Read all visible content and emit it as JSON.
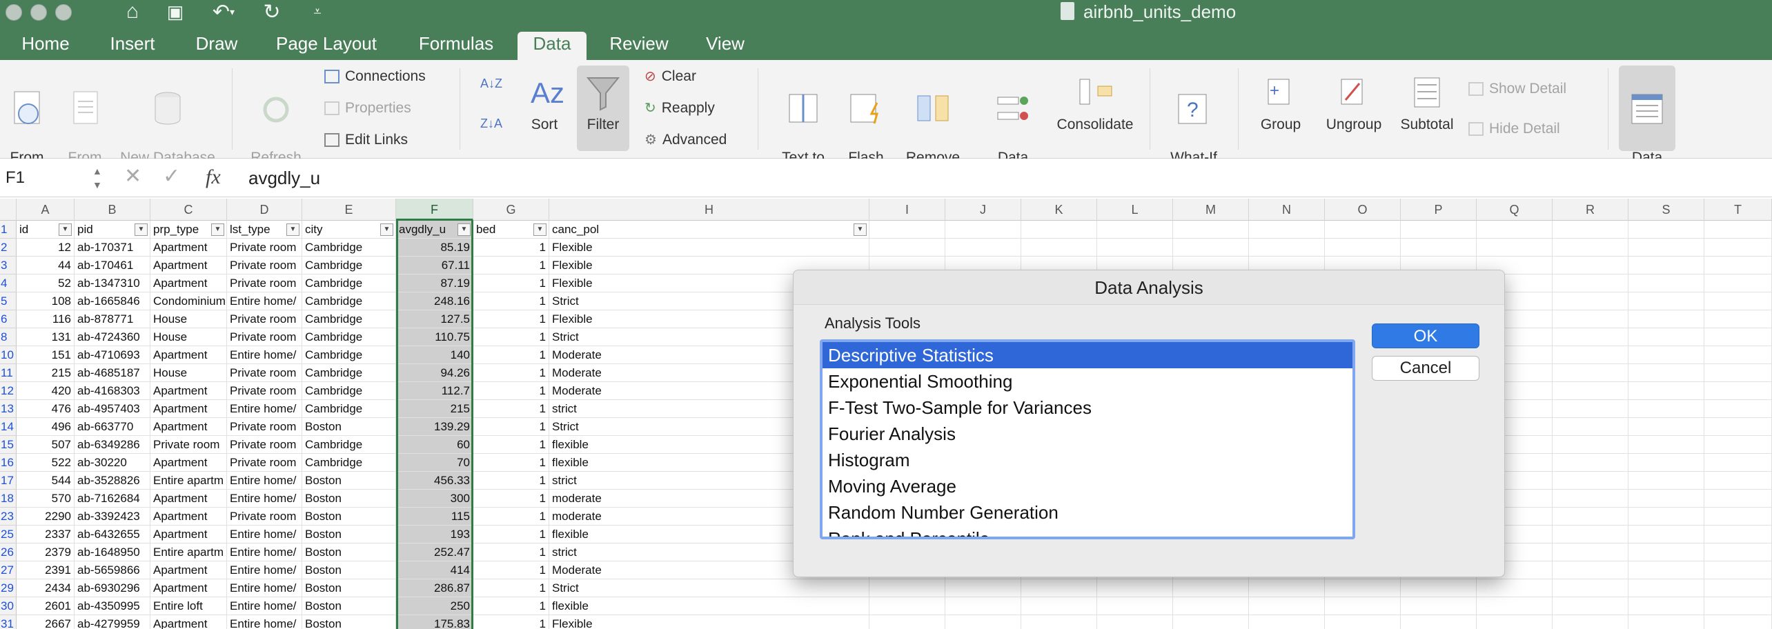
{
  "window": {
    "title": "airbnb_units_demo"
  },
  "tabs": [
    {
      "label": "Home",
      "active": false
    },
    {
      "label": "Insert",
      "active": false
    },
    {
      "label": "Draw",
      "active": false
    },
    {
      "label": "Page Layout",
      "active": false
    },
    {
      "label": "Formulas",
      "active": false
    },
    {
      "label": "Data",
      "active": true
    },
    {
      "label": "Review",
      "active": false
    },
    {
      "label": "View",
      "active": false
    }
  ],
  "ribbon": {
    "from_html": "From\nHTML",
    "from_text": "From\nText",
    "new_db_query": "New Database\nQuery",
    "refresh_all": "Refresh\nAll",
    "connections": "Connections",
    "properties": "Properties",
    "edit_links": "Edit Links",
    "sort": "Sort",
    "filter": "Filter",
    "clear": "Clear",
    "reapply": "Reapply",
    "advanced": "Advanced",
    "text_to_columns": "Text to\nColumns",
    "flash_fill": "Flash\nFill",
    "remove_duplicates": "Remove\nDuplicates",
    "data_validation": "Data\nValidation",
    "consolidate": "Consolidate",
    "what_if": "What-If\nAnalysis",
    "group": "Group",
    "ungroup": "Ungroup",
    "subtotal": "Subtotal",
    "show_detail": "Show Detail",
    "hide_detail": "Hide Detail",
    "data_analysis": "Data\nAnalysis"
  },
  "formula_bar": {
    "name_box": "F1",
    "fx": "fx",
    "value": "avgdly_u"
  },
  "columns": [
    "A",
    "B",
    "C",
    "D",
    "E",
    "F",
    "G",
    "H",
    "I",
    "J",
    "K",
    "L",
    "M",
    "N",
    "O",
    "P",
    "Q",
    "R",
    "S",
    "T"
  ],
  "header_row": {
    "row": "1",
    "cells": [
      "id",
      "pid",
      "prp_type",
      "lst_type",
      "city",
      "avgdly_u",
      "bed",
      "canc_pol"
    ]
  },
  "rows": [
    {
      "row": "2",
      "cells": [
        "12",
        "ab-170371",
        "Apartment",
        "Private room",
        "Cambridge",
        "85.19",
        "1",
        "Flexible"
      ]
    },
    {
      "row": "3",
      "cells": [
        "44",
        "ab-170461",
        "Apartment",
        "Private room",
        "Cambridge",
        "67.11",
        "1",
        "Flexible"
      ]
    },
    {
      "row": "4",
      "cells": [
        "52",
        "ab-1347310",
        "Apartment",
        "Private room",
        "Cambridge",
        "87.19",
        "1",
        "Flexible"
      ]
    },
    {
      "row": "5",
      "cells": [
        "108",
        "ab-1665846",
        "Condominium",
        "Entire home/",
        "Cambridge",
        "248.16",
        "1",
        "Strict"
      ]
    },
    {
      "row": "6",
      "cells": [
        "116",
        "ab-878771",
        "House",
        "Private room",
        "Cambridge",
        "127.5",
        "1",
        "Flexible"
      ]
    },
    {
      "row": "8",
      "cells": [
        "131",
        "ab-4724360",
        "House",
        "Private room",
        "Cambridge",
        "110.75",
        "1",
        "Strict"
      ]
    },
    {
      "row": "10",
      "cells": [
        "151",
        "ab-4710693",
        "Apartment",
        "Entire home/",
        "Cambridge",
        "140",
        "1",
        "Moderate"
      ]
    },
    {
      "row": "11",
      "cells": [
        "215",
        "ab-4685187",
        "House",
        "Private room",
        "Cambridge",
        "94.26",
        "1",
        "Moderate"
      ]
    },
    {
      "row": "12",
      "cells": [
        "420",
        "ab-4168303",
        "Apartment",
        "Private room",
        "Cambridge",
        "112.7",
        "1",
        "Moderate"
      ]
    },
    {
      "row": "13",
      "cells": [
        "476",
        "ab-4957403",
        "Apartment",
        "Entire home/",
        "Cambridge",
        "215",
        "1",
        "strict"
      ]
    },
    {
      "row": "14",
      "cells": [
        "496",
        "ab-663770",
        "Apartment",
        "Private room",
        "Boston",
        "139.29",
        "1",
        "Strict"
      ]
    },
    {
      "row": "15",
      "cells": [
        "507",
        "ab-6349286",
        "Private room",
        "Private room",
        "Cambridge",
        "60",
        "1",
        "flexible"
      ]
    },
    {
      "row": "16",
      "cells": [
        "522",
        "ab-30220",
        "Apartment",
        "Private room",
        "Cambridge",
        "70",
        "1",
        "flexible"
      ]
    },
    {
      "row": "17",
      "cells": [
        "544",
        "ab-3528826",
        "Entire apartm",
        "Entire home/",
        "Boston",
        "456.33",
        "1",
        "strict"
      ]
    },
    {
      "row": "18",
      "cells": [
        "570",
        "ab-7162684",
        "Apartment",
        "Entire home/",
        "Boston",
        "300",
        "1",
        "moderate"
      ]
    },
    {
      "row": "23",
      "cells": [
        "2290",
        "ab-3392423",
        "Apartment",
        "Private room",
        "Boston",
        "115",
        "1",
        "moderate"
      ]
    },
    {
      "row": "25",
      "cells": [
        "2337",
        "ab-6432655",
        "Apartment",
        "Entire home/",
        "Boston",
        "193",
        "1",
        "flexible"
      ]
    },
    {
      "row": "26",
      "cells": [
        "2379",
        "ab-1648950",
        "Entire apartm",
        "Entire home/",
        "Boston",
        "252.47",
        "1",
        "strict"
      ]
    },
    {
      "row": "27",
      "cells": [
        "2391",
        "ab-5659866",
        "Apartment",
        "Entire home/",
        "Boston",
        "414",
        "1",
        "Moderate"
      ]
    },
    {
      "row": "29",
      "cells": [
        "2434",
        "ab-6930296",
        "Apartment",
        "Entire home/",
        "Boston",
        "286.87",
        "1",
        "Strict"
      ]
    },
    {
      "row": "30",
      "cells": [
        "2601",
        "ab-4350995",
        "Entire loft",
        "Entire home/",
        "Boston",
        "250",
        "1",
        "flexible"
      ]
    },
    {
      "row": "31",
      "cells": [
        "2667",
        "ab-4279959",
        "Apartment",
        "Entire home/",
        "Boston",
        "175.83",
        "1",
        "Flexible"
      ]
    }
  ],
  "dialog": {
    "title": "Data Analysis",
    "tools_label": "Analysis Tools",
    "tools": [
      "Descriptive Statistics",
      "Exponential Smoothing",
      "F-Test Two-Sample for Variances",
      "Fourier Analysis",
      "Histogram",
      "Moving Average",
      "Random Number Generation",
      "Rank and Percentile"
    ],
    "selected_tool": "Descriptive Statistics",
    "ok_label": "OK",
    "cancel_label": "Cancel"
  },
  "colors": {
    "excel_green": "#487f58",
    "selection_blue": "#2f67d8",
    "ok_blue": "#2f7ae5"
  }
}
